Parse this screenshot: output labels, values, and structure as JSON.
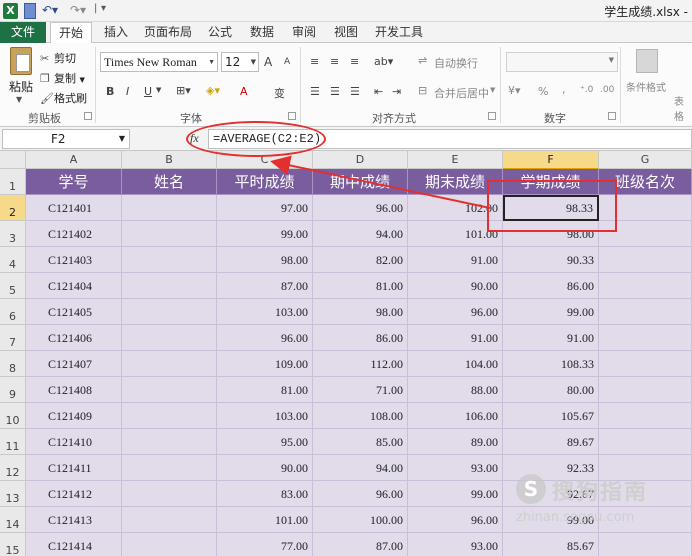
{
  "window": {
    "title": "学生成绩.xlsx -"
  },
  "quick_access": {
    "separator": "|",
    "customize": "▾"
  },
  "tabs": [
    "文件",
    "开始",
    "插入",
    "页面布局",
    "公式",
    "数据",
    "审阅",
    "视图",
    "开发工具"
  ],
  "ribbon": {
    "clipboard": {
      "paste": "粘贴",
      "cut": "剪切",
      "copy": "复制",
      "format_painter": "格式刷",
      "label": "剪贴板"
    },
    "font": {
      "name": "Times New Roman",
      "size": "12",
      "bold": "B",
      "italic": "I",
      "underline": "U",
      "grow": "A",
      "shrink": "A",
      "color": "A",
      "phonetic": "变",
      "label": "字体"
    },
    "alignment": {
      "wrap": "自动换行",
      "merge": "合并后居中",
      "label": "对齐方式"
    },
    "number": {
      "percent": "%",
      "comma": ",",
      "label": "数字"
    },
    "styles": {
      "conditional": "条件格式",
      "table": "表格"
    }
  },
  "formula_bar": {
    "cell_ref": "F2",
    "fx": "fx",
    "formula": "=AVERAGE(C2:E2)"
  },
  "columns": [
    "A",
    "B",
    "C",
    "D",
    "E",
    "F",
    "G"
  ],
  "active_column": "F",
  "active_row": "2",
  "header_row": [
    "学号",
    "姓名",
    "平时成绩",
    "期中成绩",
    "期末成绩",
    "学期成绩",
    "班级名次"
  ],
  "rows": [
    {
      "n": "2",
      "id": "C121401",
      "name": "",
      "c": "97.00",
      "d": "96.00",
      "e": "102.00",
      "f": "98.33",
      "g": ""
    },
    {
      "n": "3",
      "id": "C121402",
      "name": "",
      "c": "99.00",
      "d": "94.00",
      "e": "101.00",
      "f": "98.00",
      "g": ""
    },
    {
      "n": "4",
      "id": "C121403",
      "name": "",
      "c": "98.00",
      "d": "82.00",
      "e": "91.00",
      "f": "90.33",
      "g": ""
    },
    {
      "n": "5",
      "id": "C121404",
      "name": "",
      "c": "87.00",
      "d": "81.00",
      "e": "90.00",
      "f": "86.00",
      "g": ""
    },
    {
      "n": "6",
      "id": "C121405",
      "name": "",
      "c": "103.00",
      "d": "98.00",
      "e": "96.00",
      "f": "99.00",
      "g": ""
    },
    {
      "n": "7",
      "id": "C121406",
      "name": "",
      "c": "96.00",
      "d": "86.00",
      "e": "91.00",
      "f": "91.00",
      "g": ""
    },
    {
      "n": "8",
      "id": "C121407",
      "name": "",
      "c": "109.00",
      "d": "112.00",
      "e": "104.00",
      "f": "108.33",
      "g": ""
    },
    {
      "n": "9",
      "id": "C121408",
      "name": "",
      "c": "81.00",
      "d": "71.00",
      "e": "88.00",
      "f": "80.00",
      "g": ""
    },
    {
      "n": "10",
      "id": "C121409",
      "name": "",
      "c": "103.00",
      "d": "108.00",
      "e": "106.00",
      "f": "105.67",
      "g": ""
    },
    {
      "n": "11",
      "id": "C121410",
      "name": "",
      "c": "95.00",
      "d": "85.00",
      "e": "89.00",
      "f": "89.67",
      "g": ""
    },
    {
      "n": "12",
      "id": "C121411",
      "name": "",
      "c": "90.00",
      "d": "94.00",
      "e": "93.00",
      "f": "92.33",
      "g": ""
    },
    {
      "n": "13",
      "id": "C121412",
      "name": "",
      "c": "83.00",
      "d": "96.00",
      "e": "99.00",
      "f": "92.67",
      "g": ""
    },
    {
      "n": "14",
      "id": "C121413",
      "name": "",
      "c": "101.00",
      "d": "100.00",
      "e": "96.00",
      "f": "99.00",
      "g": ""
    },
    {
      "n": "15",
      "id": "C121414",
      "name": "",
      "c": "77.00",
      "d": "87.00",
      "e": "93.00",
      "f": "85.67",
      "g": ""
    }
  ],
  "watermark": {
    "title": "搜狗指南",
    "url": "zhinan.sogou.com"
  },
  "colors": {
    "header_bg": "#7a5d9e",
    "cell_bg": "#e1dbea",
    "annotation": "#e3302f",
    "file_tab": "#1e7145"
  }
}
